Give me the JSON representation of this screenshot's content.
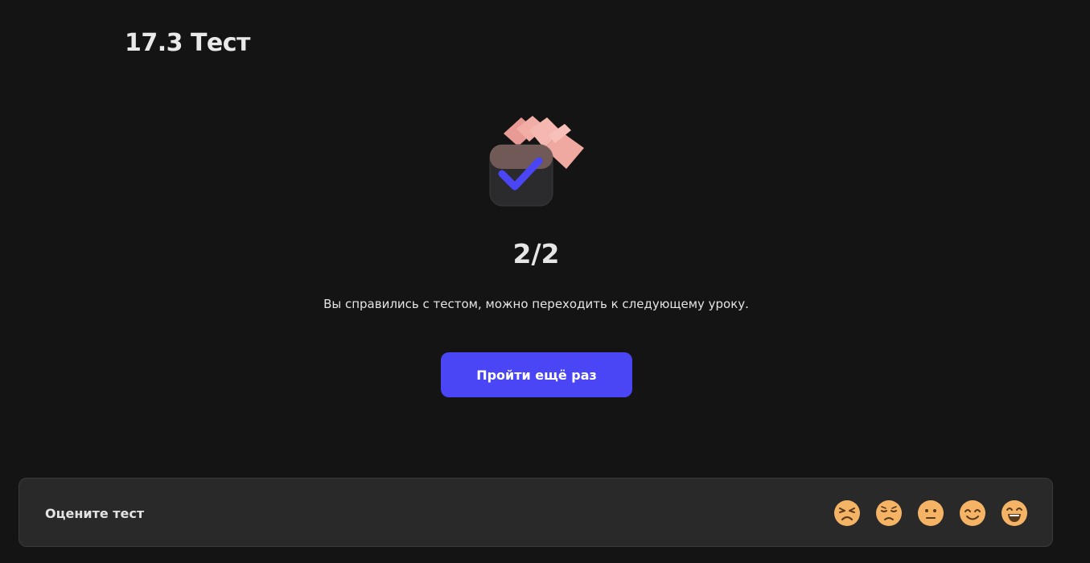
{
  "page": {
    "title": "17.3 Тест"
  },
  "result": {
    "score": "2/2",
    "message": "Вы справились с тестом, можно переходить к следующему уроку."
  },
  "actions": {
    "retry_label": "Пройти ещё раз"
  },
  "rating": {
    "label": "Оцените тест",
    "options": [
      {
        "icon": "angry-face-icon"
      },
      {
        "icon": "sad-face-icon"
      },
      {
        "icon": "neutral-face-icon"
      },
      {
        "icon": "smiling-face-icon"
      },
      {
        "icon": "grinning-face-icon"
      }
    ]
  },
  "colors": {
    "background": "#141414",
    "accent": "#4a46f6",
    "panel": "#292929",
    "emoji_fill": "#f5b366",
    "confetti": "#f3b0a8",
    "check": "#4a46f6"
  }
}
